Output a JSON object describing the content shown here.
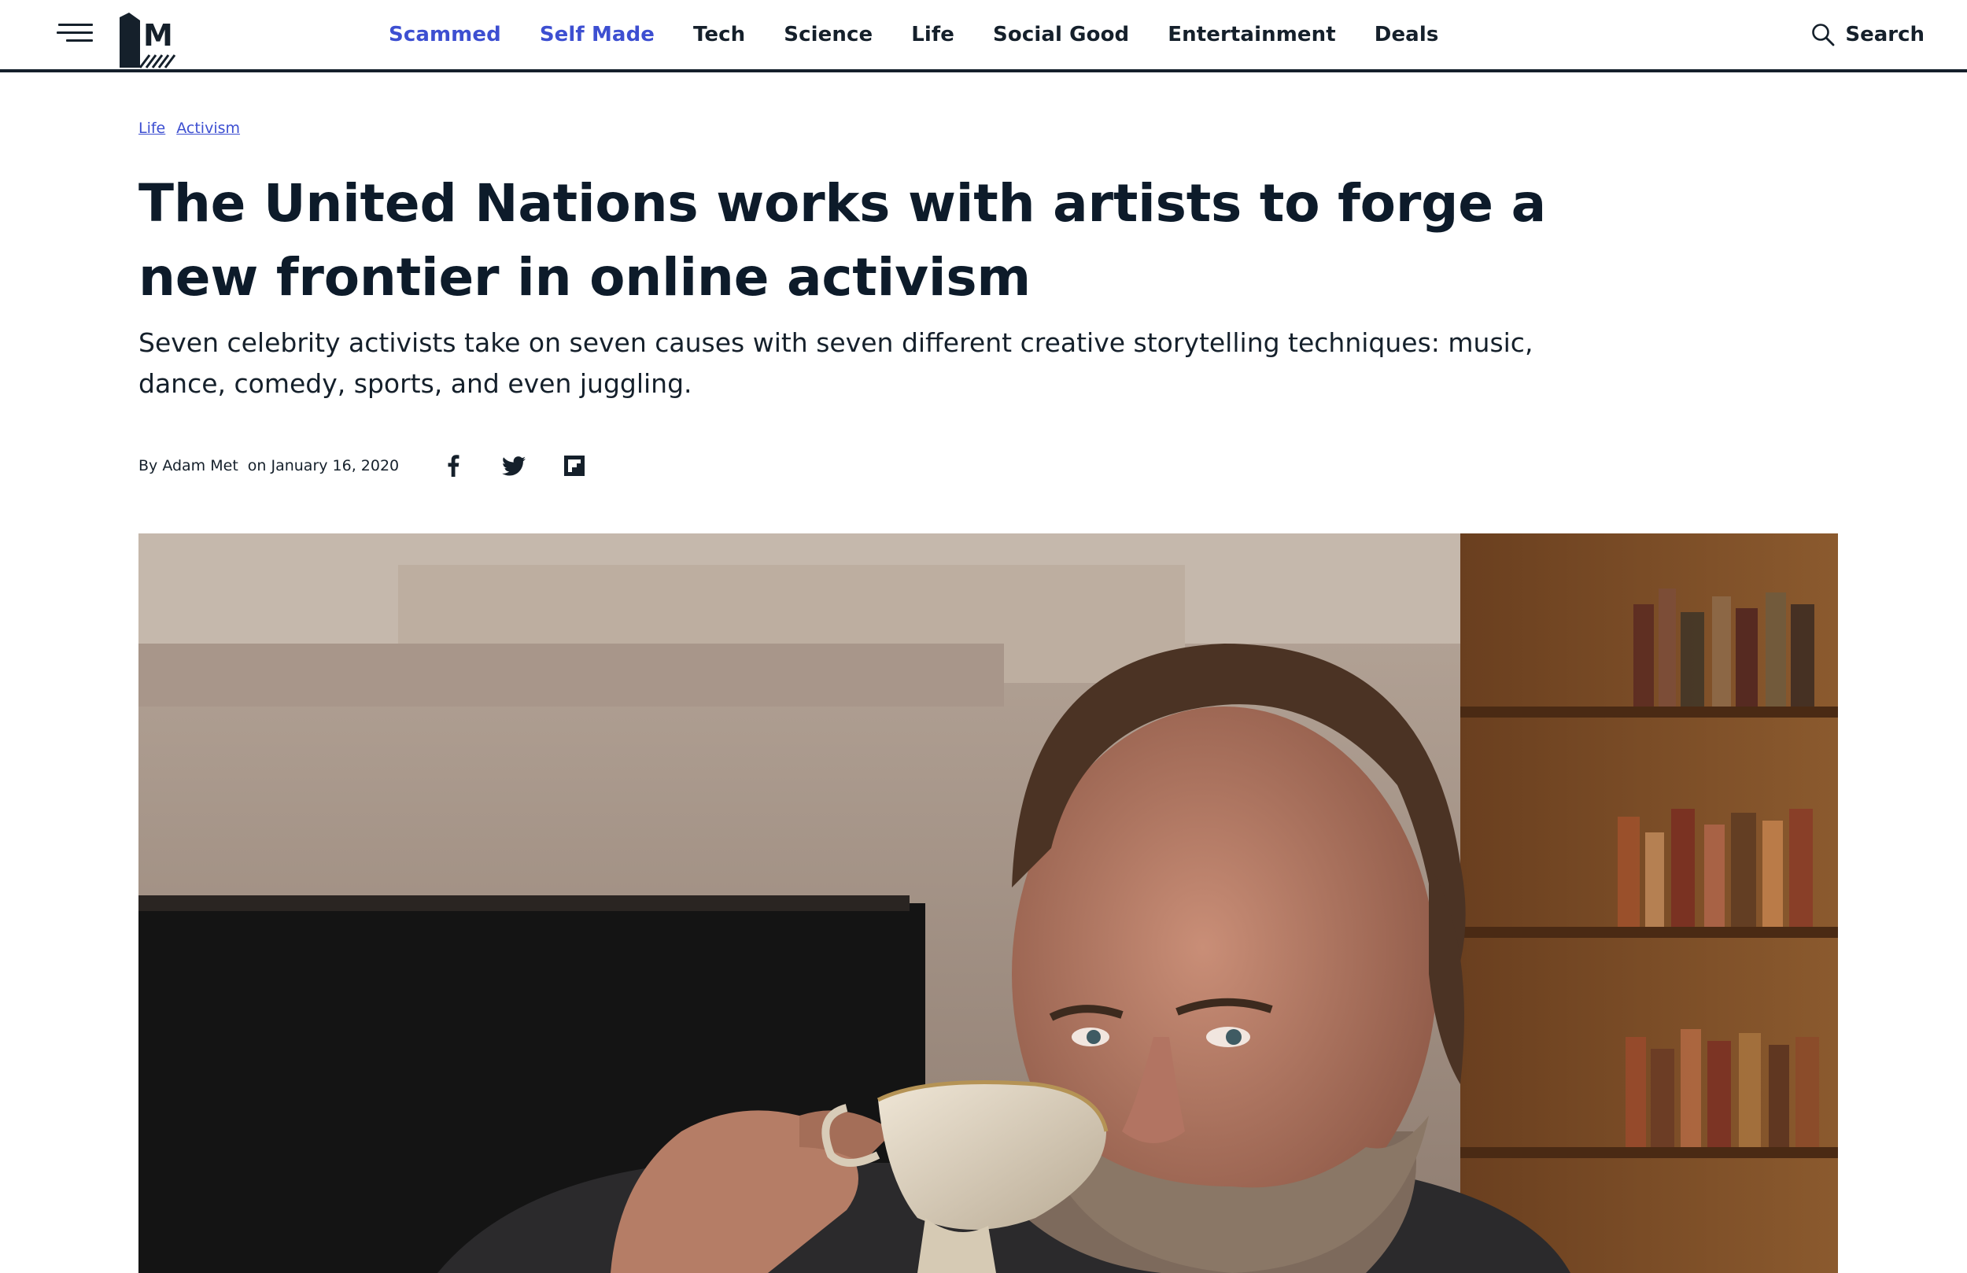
{
  "header": {
    "nav": [
      {
        "label": "Scammed",
        "accent": true
      },
      {
        "label": "Self Made",
        "accent": true
      },
      {
        "label": "Tech",
        "accent": false
      },
      {
        "label": "Science",
        "accent": false
      },
      {
        "label": "Life",
        "accent": false
      },
      {
        "label": "Social Good",
        "accent": false
      },
      {
        "label": "Entertainment",
        "accent": false
      },
      {
        "label": "Deals",
        "accent": false
      }
    ],
    "search_label": "Search",
    "menu_icon": "hamburger-menu-icon",
    "logo_letter": "M"
  },
  "article": {
    "tags": [
      "Life",
      "Activism"
    ],
    "headline": "The United Nations works with artists to forge a new frontier in online activism",
    "dek": "Seven celebrity activists take on seven causes with seven different creative storytelling techniques: music, dance, comedy, sports, and even juggling.",
    "byline_author": "By Adam Met",
    "byline_date": "on January 16, 2020",
    "share": [
      {
        "icon": "facebook-icon"
      },
      {
        "icon": "twitter-icon"
      },
      {
        "icon": "flipboard-icon"
      }
    ],
    "hero_alt": "hero-photo"
  },
  "colors": {
    "accent": "#3d4fd1",
    "text": "#0d1b2a",
    "header_rule": "#15202b"
  }
}
